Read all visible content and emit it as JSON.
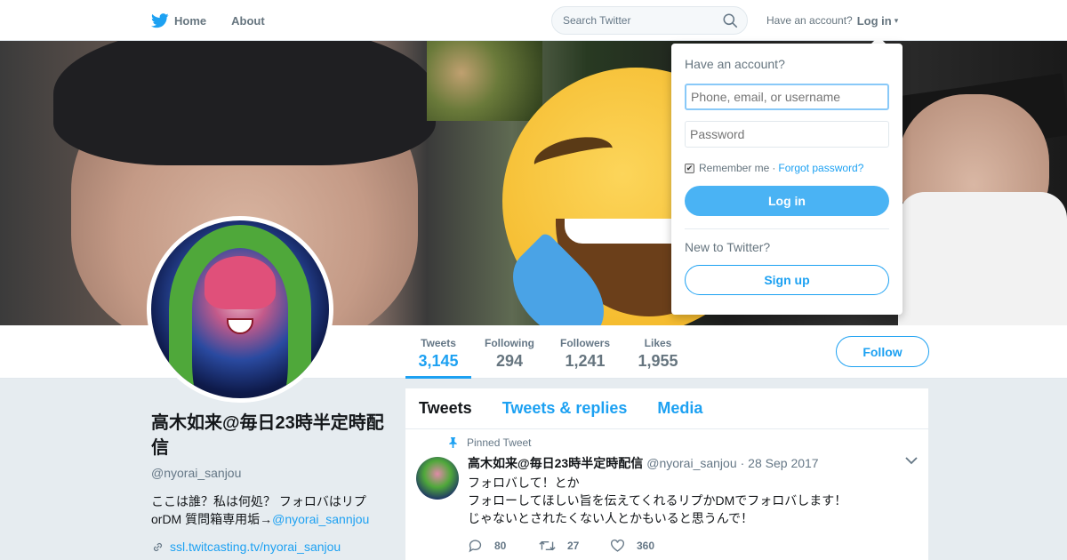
{
  "nav": {
    "home_label": "Home",
    "about_label": "About",
    "search_placeholder": "Search Twitter",
    "have_account_text": "Have an account?",
    "login_label": "Log in",
    "caret": "▾"
  },
  "profile": {
    "name": "高木如来@毎日23時半定時配信",
    "handle": "@nyorai_sanjou",
    "bio_text": "ここは誰？私は何処？ フォロバはリプorDM 質問箱専用垢→",
    "bio_mention": "@nyorai_sannjou",
    "link": "ssl.twitcasting.tv/nyorai_sanjou"
  },
  "stats": [
    {
      "label": "Tweets",
      "value": "3,145"
    },
    {
      "label": "Following",
      "value": "294"
    },
    {
      "label": "Followers",
      "value": "1,241"
    },
    {
      "label": "Likes",
      "value": "1,955"
    }
  ],
  "follow_label": "Follow",
  "timeline": {
    "tabs": [
      "Tweets",
      "Tweets & replies",
      "Media"
    ],
    "tweet": {
      "pinned_label": "Pinned Tweet",
      "name": "高木如来@毎日23時半定時配信",
      "handle": "@nyorai_sanjou",
      "date": "· 28 Sep 2017",
      "lines": [
        "フォロバして！とか",
        "フォローしてほしい旨を伝えてくれるリプかDMでフォロバします！",
        "じゃないとされたくない人とかもいると思うんで！"
      ],
      "replies": "80",
      "retweets": "27",
      "likes": "360"
    }
  },
  "login_dropdown": {
    "title": "Have an account?",
    "username_placeholder": "Phone, email, or username",
    "password_placeholder": "Password",
    "remember_label": "Remember me",
    "separator": "·",
    "forgot_label": "Forgot password?",
    "login_button": "Log in",
    "new_text": "New to Twitter?",
    "signup_button": "Sign up"
  },
  "colors": {
    "accent": "#1da1f2",
    "background": "#e6ecf0"
  }
}
